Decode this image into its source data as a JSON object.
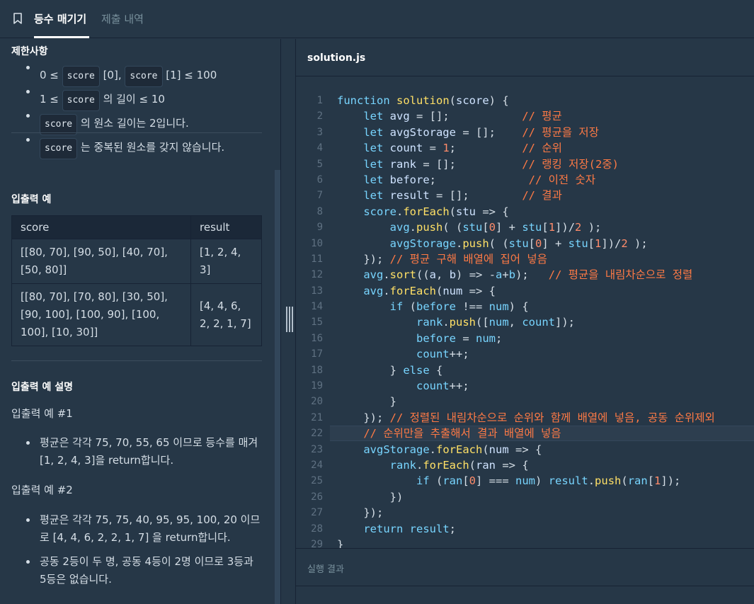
{
  "tabs": {
    "active": "등수 매기기",
    "inactive": "제출 내역"
  },
  "left": {
    "constraints_title": "제한사항",
    "constraints": [
      {
        "a": "0 ≤ ",
        "chip1": "score",
        "b": " [0], ",
        "chip2": "score",
        "c": " [1] ≤ 100"
      },
      {
        "a": "1 ≤ ",
        "chip1": "score",
        "b": " 의 길이 ≤ 10"
      },
      {
        "chip1": "score",
        "b": " 의 원소 길이는 2입니다."
      },
      {
        "chip1": "score",
        "b": " 는 중복된 원소를 갖지 않습니다."
      }
    ],
    "io_title": "입출력 예",
    "io_table": {
      "headers": [
        "score",
        "result"
      ],
      "rows": [
        [
          "[[80, 70], [90, 50], [40, 70], [50, 80]]",
          "[1, 2, 4, 3]"
        ],
        [
          "[[80, 70], [70, 80], [30, 50], [90, 100], [100, 90], [100, 100], [10, 30]]",
          "[4, 4, 6, 2, 2, 1, 7]"
        ]
      ]
    },
    "explain_title": "입출력 예 설명",
    "example1_title": "입출력 예 #1",
    "example1_items": [
      "평균은 각각 75, 70, 55, 65 이므로 등수를 매겨 [1, 2, 4, 3]을 return합니다."
    ],
    "example2_title": "입출력 예 #2",
    "example2_items": [
      "평균은 각각 75, 75, 40, 95, 95, 100, 20 이므로 [4, 4, 6, 2, 2, 1, 7] 을 return합니다.",
      "공동 2등이 두 명, 공동 4등이 2명 이므로 3등과 5등은 없습니다."
    ]
  },
  "editor": {
    "file_name": "solution.js",
    "line_numbers": [
      "1",
      "2",
      "3",
      "4",
      "5",
      "6",
      "7",
      "8",
      "9",
      "10",
      "11",
      "12",
      "13",
      "14",
      "15",
      "16",
      "17",
      "18",
      "19",
      "20",
      "21",
      "22",
      "23",
      "24",
      "25",
      "26",
      "27",
      "28",
      "29"
    ],
    "lines": [
      [
        [
          "kw",
          "function "
        ],
        [
          "fn",
          "solution"
        ],
        [
          "op",
          "("
        ],
        [
          "var",
          "score"
        ],
        [
          "op",
          ") {"
        ]
      ],
      [
        [
          "op",
          "    "
        ],
        [
          "kw",
          "let "
        ],
        [
          "var",
          "avg"
        ],
        [
          "op",
          " = [];           "
        ],
        [
          "cm",
          "// 평균"
        ]
      ],
      [
        [
          "op",
          "    "
        ],
        [
          "kw",
          "let "
        ],
        [
          "var",
          "avgStorage"
        ],
        [
          "op",
          " = [];    "
        ],
        [
          "cm",
          "// 평균을 저장"
        ]
      ],
      [
        [
          "op",
          "    "
        ],
        [
          "kw",
          "let "
        ],
        [
          "var",
          "count"
        ],
        [
          "op",
          " = "
        ],
        [
          "num",
          "1"
        ],
        [
          "op",
          ";          "
        ],
        [
          "cm",
          "// 순위"
        ]
      ],
      [
        [
          "op",
          "    "
        ],
        [
          "kw",
          "let "
        ],
        [
          "var",
          "rank"
        ],
        [
          "op",
          " = [];          "
        ],
        [
          "cm",
          "// 랭킹 저장(2중)"
        ]
      ],
      [
        [
          "op",
          "    "
        ],
        [
          "kw",
          "let "
        ],
        [
          "var",
          "before"
        ],
        [
          "op",
          ";              "
        ],
        [
          "cm",
          "// 이전 숫자"
        ]
      ],
      [
        [
          "op",
          "    "
        ],
        [
          "kw",
          "let "
        ],
        [
          "var",
          "result"
        ],
        [
          "op",
          " = [];        "
        ],
        [
          "cm",
          "// 결과"
        ]
      ],
      [
        [
          "op",
          "    "
        ],
        [
          "kw",
          "score"
        ],
        [
          "op",
          "."
        ],
        [
          "fn",
          "forEach"
        ],
        [
          "op",
          "("
        ],
        [
          "var",
          "stu"
        ],
        [
          "op",
          " => {"
        ]
      ],
      [
        [
          "op",
          "        "
        ],
        [
          "kw",
          "avg"
        ],
        [
          "op",
          "."
        ],
        [
          "fn",
          "push"
        ],
        [
          "op",
          "( ("
        ],
        [
          "kw",
          "stu"
        ],
        [
          "op",
          "["
        ],
        [
          "num",
          "0"
        ],
        [
          "op",
          "] + "
        ],
        [
          "kw",
          "stu"
        ],
        [
          "op",
          "["
        ],
        [
          "num",
          "1"
        ],
        [
          "op",
          "])/"
        ],
        [
          "num",
          "2"
        ],
        [
          "op",
          " );"
        ]
      ],
      [
        [
          "op",
          "        "
        ],
        [
          "kw",
          "avgStorage"
        ],
        [
          "op",
          "."
        ],
        [
          "fn",
          "push"
        ],
        [
          "op",
          "( ("
        ],
        [
          "kw",
          "stu"
        ],
        [
          "op",
          "["
        ],
        [
          "num",
          "0"
        ],
        [
          "op",
          "] + "
        ],
        [
          "kw",
          "stu"
        ],
        [
          "op",
          "["
        ],
        [
          "num",
          "1"
        ],
        [
          "op",
          "])/"
        ],
        [
          "num",
          "2"
        ],
        [
          "op",
          " );"
        ]
      ],
      [
        [
          "op",
          "    }); "
        ],
        [
          "cm",
          "// 평균 구해 배열에 집어 넣음"
        ]
      ],
      [
        [
          "op",
          "    "
        ],
        [
          "kw",
          "avg"
        ],
        [
          "op",
          "."
        ],
        [
          "fn",
          "sort"
        ],
        [
          "op",
          "(("
        ],
        [
          "var",
          "a"
        ],
        [
          "op",
          ", "
        ],
        [
          "var",
          "b"
        ],
        [
          "op",
          ") => -"
        ],
        [
          "kw",
          "a"
        ],
        [
          "op",
          "+"
        ],
        [
          "kw",
          "b"
        ],
        [
          "op",
          ");   "
        ],
        [
          "cm",
          "// 평균을 내림차순으로 정렬"
        ]
      ],
      [
        [
          "op",
          "    "
        ],
        [
          "kw",
          "avg"
        ],
        [
          "op",
          "."
        ],
        [
          "fn",
          "forEach"
        ],
        [
          "op",
          "("
        ],
        [
          "var",
          "num"
        ],
        [
          "op",
          " => {"
        ]
      ],
      [
        [
          "op",
          "        "
        ],
        [
          "kw",
          "if"
        ],
        [
          "op",
          " ("
        ],
        [
          "kw",
          "before"
        ],
        [
          "op",
          " !== "
        ],
        [
          "kw",
          "num"
        ],
        [
          "op",
          ") {"
        ]
      ],
      [
        [
          "op",
          "            "
        ],
        [
          "kw",
          "rank"
        ],
        [
          "op",
          "."
        ],
        [
          "fn",
          "push"
        ],
        [
          "op",
          "(["
        ],
        [
          "kw",
          "num"
        ],
        [
          "op",
          ", "
        ],
        [
          "kw",
          "count"
        ],
        [
          "op",
          "]);"
        ]
      ],
      [
        [
          "op",
          "            "
        ],
        [
          "kw",
          "before"
        ],
        [
          "op",
          " = "
        ],
        [
          "kw",
          "num"
        ],
        [
          "op",
          ";"
        ]
      ],
      [
        [
          "op",
          "            "
        ],
        [
          "kw",
          "count"
        ],
        [
          "op",
          "++;"
        ]
      ],
      [
        [
          "op",
          "        } "
        ],
        [
          "kw",
          "else"
        ],
        [
          "op",
          " {"
        ]
      ],
      [
        [
          "op",
          "            "
        ],
        [
          "kw",
          "count"
        ],
        [
          "op",
          "++;"
        ]
      ],
      [
        [
          "op",
          "        }"
        ]
      ],
      [
        [
          "op",
          "    }); "
        ],
        [
          "cm",
          "// 정렬된 내림차순으로 순위와 함께 배열에 넣음, 공동 순위제외"
        ]
      ],
      [
        [
          "op",
          "    "
        ],
        [
          "cm",
          "// 순위만을 추출해서 결과 배열에 넣음"
        ]
      ],
      [
        [
          "op",
          "    "
        ],
        [
          "kw",
          "avgStorage"
        ],
        [
          "op",
          "."
        ],
        [
          "fn",
          "forEach"
        ],
        [
          "op",
          "("
        ],
        [
          "var",
          "num"
        ],
        [
          "op",
          " => {"
        ]
      ],
      [
        [
          "op",
          "        "
        ],
        [
          "kw",
          "rank"
        ],
        [
          "op",
          "."
        ],
        [
          "fn",
          "forEach"
        ],
        [
          "op",
          "("
        ],
        [
          "var",
          "ran"
        ],
        [
          "op",
          " => {"
        ]
      ],
      [
        [
          "op",
          "            "
        ],
        [
          "kw",
          "if"
        ],
        [
          "op",
          " ("
        ],
        [
          "kw",
          "ran"
        ],
        [
          "op",
          "["
        ],
        [
          "num",
          "0"
        ],
        [
          "op",
          "] === "
        ],
        [
          "kw",
          "num"
        ],
        [
          "op",
          ") "
        ],
        [
          "kw",
          "result"
        ],
        [
          "op",
          "."
        ],
        [
          "fn",
          "push"
        ],
        [
          "op",
          "("
        ],
        [
          "kw",
          "ran"
        ],
        [
          "op",
          "["
        ],
        [
          "num",
          "1"
        ],
        [
          "op",
          "]);"
        ]
      ],
      [
        [
          "op",
          "        })"
        ]
      ],
      [
        [
          "op",
          "    });"
        ]
      ],
      [
        [
          "op",
          "    "
        ],
        [
          "kw",
          "return "
        ],
        [
          "kw",
          "result"
        ],
        [
          "op",
          ";"
        ]
      ],
      [
        [
          "op",
          "}"
        ]
      ]
    ]
  },
  "result_panel": {
    "title": "실행 결과"
  },
  "colors": {
    "background": "#263747",
    "keyword": "#78d5ff",
    "function": "#ffe066",
    "number": "#ff8c6b",
    "comment": "#ff7a45"
  }
}
